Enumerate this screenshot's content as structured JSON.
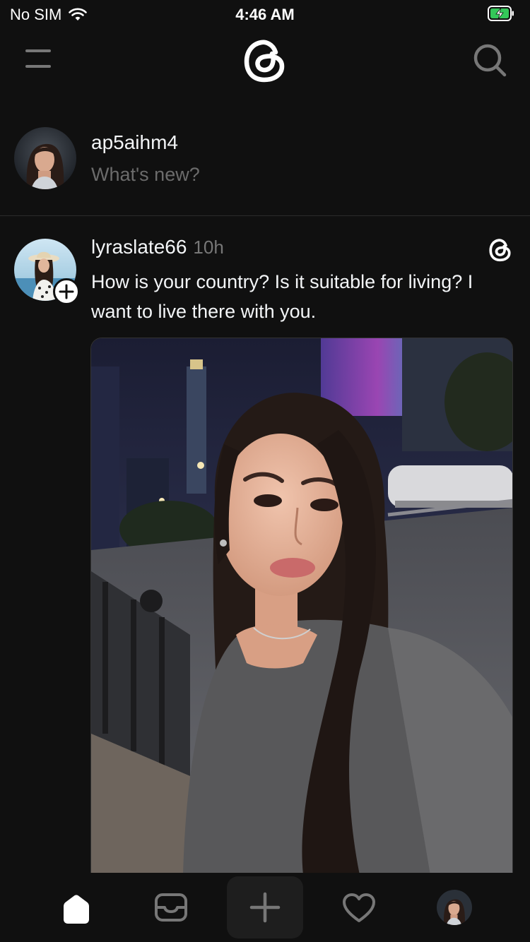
{
  "status_bar": {
    "carrier": "No SIM",
    "time": "4:46 AM"
  },
  "top_nav": {
    "menu_icon": "menu-icon",
    "logo_icon": "threads-logo-icon",
    "search_icon": "search-icon"
  },
  "composer": {
    "username": "ap5aihm4",
    "placeholder": "What's new?"
  },
  "post": {
    "username": "lyraslate66",
    "time": "10h",
    "text": "How is your country? Is it suitable for living? I want to live there with you.",
    "image_description": "selfie-photo"
  },
  "tab_bar": {
    "items": [
      "home-icon",
      "inbox-icon",
      "compose-icon",
      "activity-heart-icon",
      "profile-avatar"
    ]
  },
  "colors": {
    "background": "#101010",
    "text_primary": "#f3f5f7",
    "text_secondary": "#777777",
    "placeholder": "#6b6b6b",
    "divider": "#2b2b2b"
  }
}
